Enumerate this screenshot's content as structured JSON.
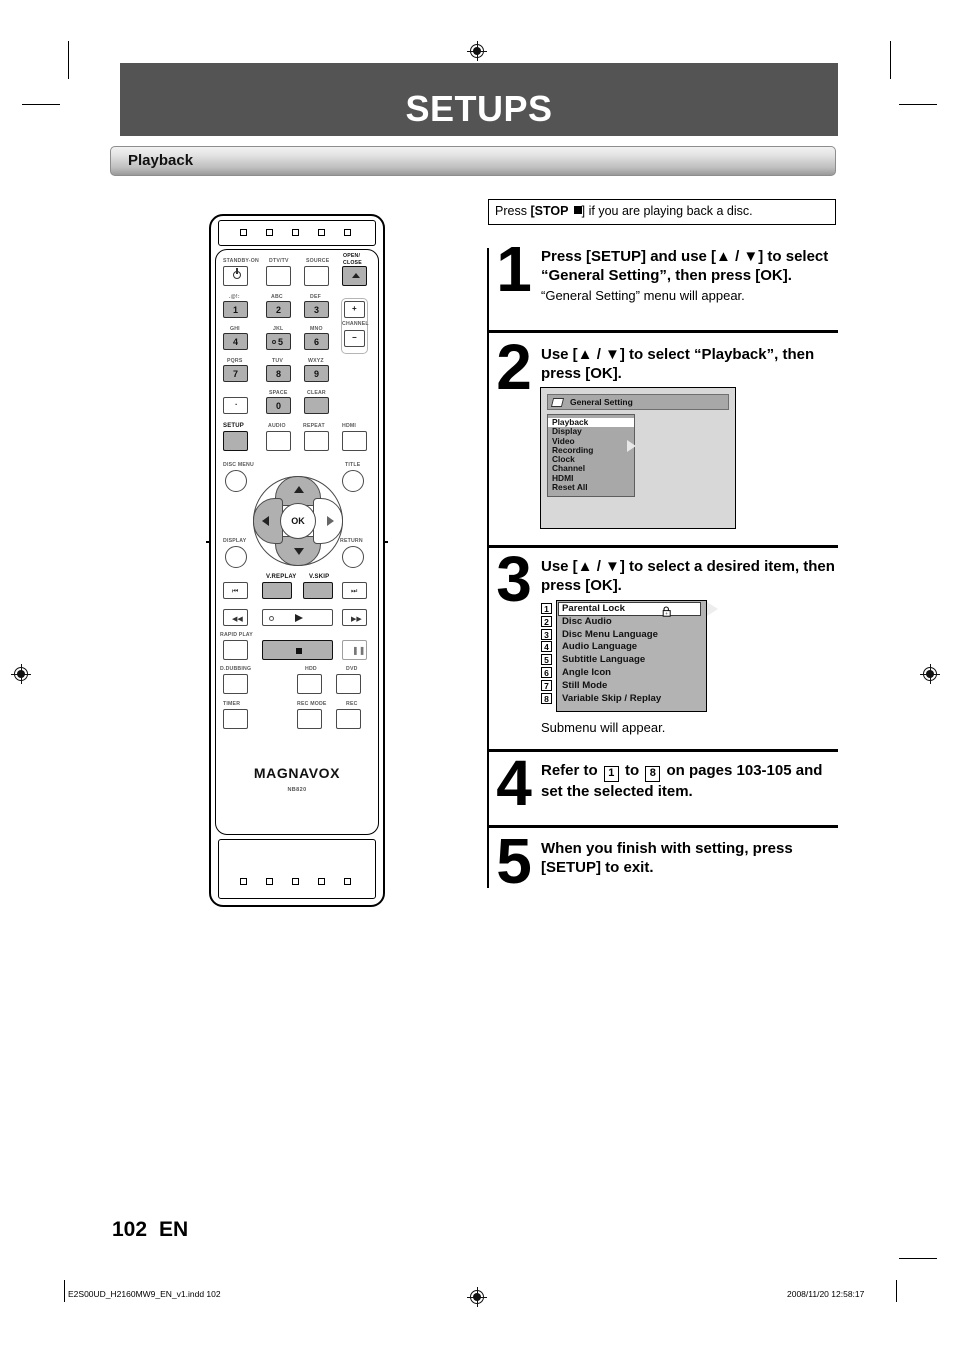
{
  "page": {
    "title": "SETUPS",
    "section": "Playback",
    "number": "102",
    "language": "EN"
  },
  "note": {
    "prefix": "Press ",
    "key": "[STOP ",
    "suffix": "] if you are playing back a disc."
  },
  "steps": [
    {
      "num": "1",
      "head": "Press [SETUP] and use [▲ / ▼] to select “General Setting”, then press [OK].",
      "sub": "“General Setting” menu will appear."
    },
    {
      "num": "2",
      "head": "Use [▲ / ▼] to select “Playback”, then press [OK].",
      "sub": ""
    },
    {
      "num": "3",
      "head": "Use [▲ / ▼] to select a desired item, then press [OK].",
      "sub": "Submenu will appear."
    },
    {
      "num": "4",
      "head_a": "Refer to ",
      "ref_from": "1",
      "head_b": " to ",
      "ref_to": "8",
      "head_c": " on pages 103-105 and set the selected item.",
      "sub": ""
    },
    {
      "num": "5",
      "head": "When you finish with setting, press [SETUP] to exit.",
      "sub": ""
    }
  ],
  "osd_general_setting": {
    "title": "General Setting",
    "items": [
      "Playback",
      "Display",
      "Video",
      "Recording",
      "Clock",
      "Channel",
      "HDMI",
      "Reset All"
    ],
    "selected_index": 0
  },
  "osd_playback_submenu": {
    "items": [
      {
        "n": "1",
        "label": "Parental Lock"
      },
      {
        "n": "2",
        "label": "Disc Audio"
      },
      {
        "n": "3",
        "label": "Disc Menu Language"
      },
      {
        "n": "4",
        "label": "Audio Language"
      },
      {
        "n": "5",
        "label": "Subtitle Language"
      },
      {
        "n": "6",
        "label": "Angle Icon"
      },
      {
        "n": "7",
        "label": "Still Mode"
      },
      {
        "n": "8",
        "label": "Variable Skip / Replay"
      }
    ],
    "selected_index": 0,
    "selected_icon": "padlock-icon"
  },
  "remote": {
    "brand": "MAGNAVOX",
    "model": "NB820",
    "buttons": {
      "standby": "STANDBY-ON",
      "dtvtv": "DTV/TV",
      "source": "SOURCE",
      "open_close_1": "OPEN/",
      "open_close_2": "CLOSE",
      "num1_alpha": ".@!:",
      "num2_alpha": "ABC",
      "num3_alpha": "DEF",
      "num4_alpha": "GHI",
      "num5_alpha": "JKL",
      "num6_alpha": "MNO",
      "num7_alpha": "PQRS",
      "num8_alpha": "TUV",
      "num9_alpha": "WXYZ",
      "space": "SPACE",
      "clear": "CLEAR",
      "channel": "CHANNEL",
      "n1": "1",
      "n2": "2",
      "n3": "3",
      "n4": "4",
      "n5": "5",
      "n6": "6",
      "n7": "7",
      "n8": "8",
      "n9": "9",
      "n0": "0",
      "ch_plus": "+",
      "ch_minus": "−",
      "setup": "SETUP",
      "audio": "AUDIO",
      "repeat": "REPEAT",
      "hdmi": "HDMI",
      "disc_menu": "DISC MENU",
      "title": "TITLE",
      "display": "DISPLAY",
      "return": "RETURN",
      "ok": "OK",
      "v_replay": "V.REPLAY",
      "v_skip": "V.SKIP",
      "rapid_play": "RAPID PLAY",
      "d_dubbing": "D.DUBBING",
      "hdd": "HDD",
      "dvd": "DVD",
      "timer": "TIMER",
      "rec_mode": "REC MODE",
      "rec": "REC"
    }
  },
  "footer": {
    "left": "E2S00UD_H2160MW9_EN_v1.indd   102",
    "right": "2008/11/20   12:58:17"
  }
}
